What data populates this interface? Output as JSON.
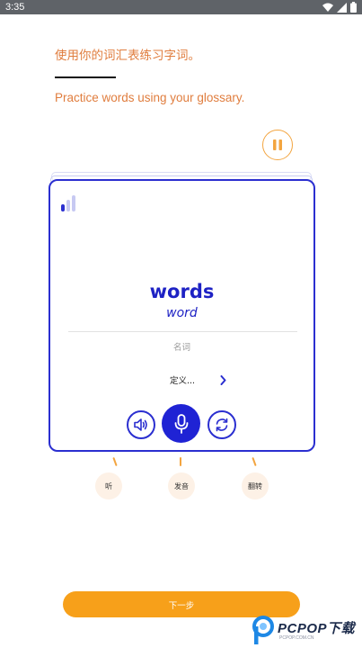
{
  "status_bar": {
    "time": "3:35",
    "icons": [
      "wifi-icon",
      "signal-icon",
      "battery-icon"
    ]
  },
  "instructions": {
    "chinese": "使用你的词汇表练习字词。",
    "english": "Practice words using your glossary."
  },
  "card": {
    "word": "words",
    "base_form": "word",
    "part_of_speech": "名词",
    "definition_label": "定义...",
    "signal_icon": "signal-strength-icon"
  },
  "controls": {
    "listen_icon": "speaker-icon",
    "pronounce_icon": "microphone-icon",
    "flip_icon": "refresh-icon"
  },
  "hints": {
    "listen": "听",
    "pronounce": "发音",
    "flip": "翻转"
  },
  "next_button": "下一步",
  "watermark": {
    "brand": "PCPOP下载",
    "url": "PCPOP.COM.CN"
  },
  "colors": {
    "accent_orange": "#f7a01a",
    "instruction_text": "#e07d3e",
    "card_blue": "#2b2fd0"
  }
}
